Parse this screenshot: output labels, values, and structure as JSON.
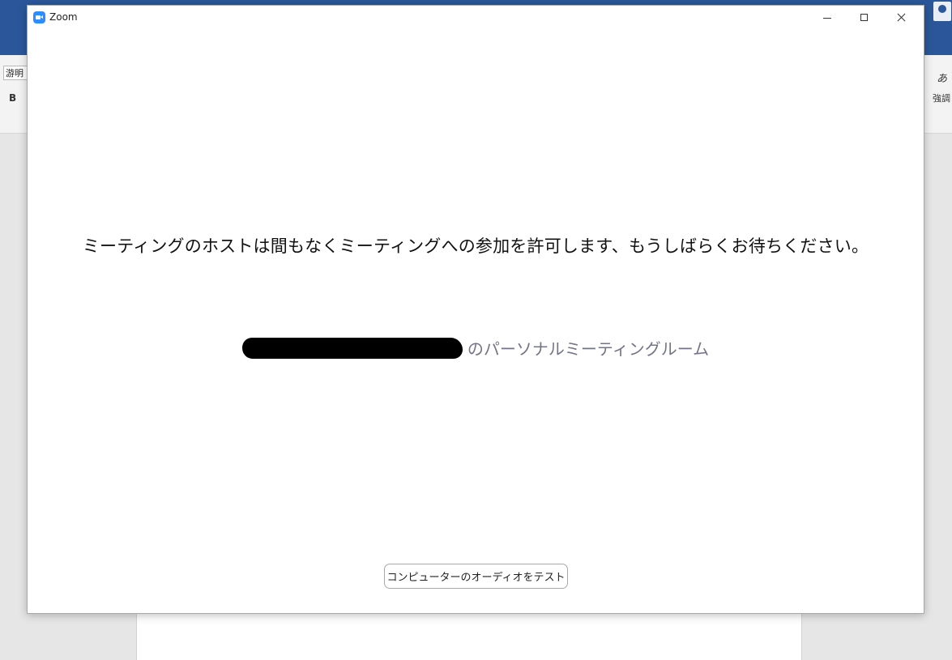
{
  "background": {
    "font_box": "游明",
    "bold_label": "B",
    "style_glyph": "あ",
    "style_label": "強調"
  },
  "window": {
    "title": "Zoom",
    "icon": "zoom-video-icon"
  },
  "main": {
    "message": "ミーティングのホストは間もなくミーティングへの参加を許可します、もうしばらくお待ちください。",
    "room_label": "のパーソナルミーティングルーム",
    "test_audio_label": "コンピューターのオーディオをテスト"
  },
  "colors": {
    "zoom_blue": "#2d8cff",
    "word_blue": "#2b579a",
    "room_label_gray": "#747487"
  }
}
